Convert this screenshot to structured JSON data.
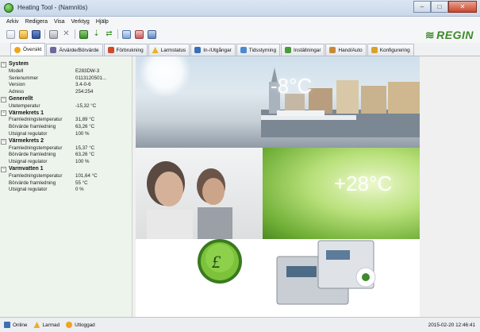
{
  "window": {
    "title": "Heating Tool - (Namnlös)",
    "controls": {
      "minimize": "–",
      "maximize": "□",
      "close": "✕"
    }
  },
  "menu": [
    "Arkiv",
    "Redigera",
    "Visa",
    "Verktyg",
    "Hjälp"
  ],
  "toolbar": {
    "icons": [
      "new-icon",
      "open-icon",
      "save-icon",
      "print-icon",
      "delete-icon",
      "export-icon",
      "import-icon",
      "transfer-icon",
      "compare-icon",
      "edit-icon",
      "settings-icon"
    ],
    "logo": "REGIN",
    "logo_mark": "≋"
  },
  "tabs": [
    {
      "label": "Översikt",
      "icon": "overview-icon",
      "color": "#f0a51a"
    },
    {
      "label": "Ärvärde/Börvärde",
      "icon": "setpoint-icon",
      "color": "#6a6a9a"
    },
    {
      "label": "Förbrukning",
      "icon": "consumption-icon",
      "color": "#d04a2a"
    },
    {
      "label": "Larmstatus",
      "icon": "alarm-icon",
      "color": "#e6b422"
    },
    {
      "label": "In-/Utgångar",
      "icon": "io-icon",
      "color": "#3a6fb8"
    },
    {
      "label": "Tidsstyrning",
      "icon": "schedule-icon",
      "color": "#4a8ad0"
    },
    {
      "label": "Inställningar",
      "icon": "settings-tab-icon",
      "color": "#4a9a3a"
    },
    {
      "label": "Hand/Auto",
      "icon": "hand-icon",
      "color": "#c88a3a"
    },
    {
      "label": "Konfigurering",
      "icon": "config-icon",
      "color": "#d8a32a"
    }
  ],
  "panel": {
    "groups": [
      {
        "title": "System",
        "rows": [
          {
            "k": "Modell",
            "v": "E283DW-3"
          },
          {
            "k": "Serienummer",
            "v": "0113120501..."
          },
          {
            "k": "Version",
            "v": "3.4-0-6"
          },
          {
            "k": "Adress",
            "v": "254:254"
          }
        ]
      },
      {
        "title": "Generellt",
        "rows": [
          {
            "k": "Utetemperatur",
            "v": "-15,32 °C"
          }
        ]
      },
      {
        "title": "Värmekrets 1",
        "rows": [
          {
            "k": "Framledningstemperatur",
            "v": "31,89 °C"
          },
          {
            "k": "Börvärde framledning",
            "v": "63,26 °C"
          },
          {
            "k": "Utsignal regulator",
            "v": "100 %"
          }
        ]
      },
      {
        "title": "Värmekrets 2",
        "rows": [
          {
            "k": "Framledningstemperatur",
            "v": "15,37 °C"
          },
          {
            "k": "Börvärde framledning",
            "v": "63,26 °C"
          },
          {
            "k": "Utsignal regulator",
            "v": "100 %"
          }
        ]
      },
      {
        "title": "Varmvatten 1",
        "rows": [
          {
            "k": "Framledningstemperatur",
            "v": "101,64 °C"
          },
          {
            "k": "Börvärde framledning",
            "v": "55 °C"
          },
          {
            "k": "Utsignal regulator",
            "v": "0 %"
          }
        ]
      }
    ]
  },
  "visual": {
    "temp_cold": "-8°C",
    "temp_warm": "+28°C"
  },
  "status": {
    "items": [
      {
        "label": "Online",
        "icon": "online-icon",
        "color": "#3a6fb8"
      },
      {
        "label": "Larmad",
        "icon": "alarm-status-icon",
        "color": "#e6b422"
      },
      {
        "label": "Utloggad",
        "icon": "user-icon",
        "color": "#f0a51a"
      }
    ],
    "datetime": "2015-02-20 12:46:41"
  }
}
